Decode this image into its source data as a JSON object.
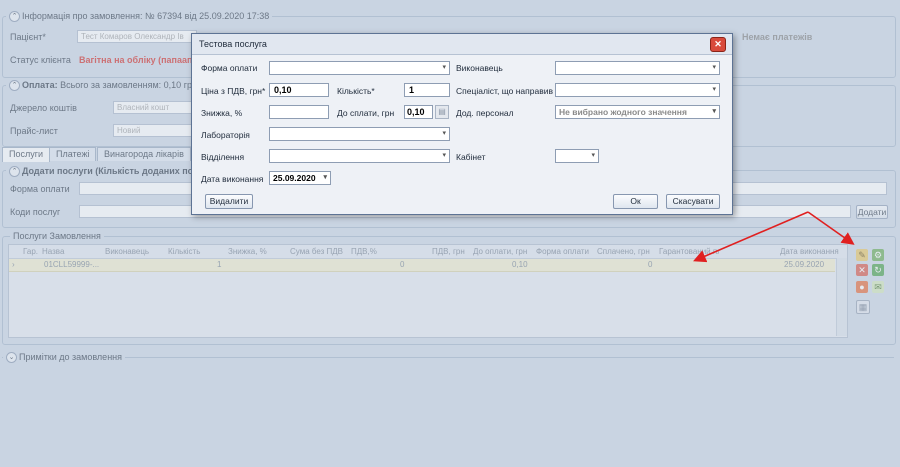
{
  "order_info": {
    "title": "Інформація про замовлення: № 67394 від 25.09.2020 17:38",
    "patient_label": "Пацієнт*",
    "patient_value": "Тест Комаров Олександр Ів",
    "status_label": "Статус клієнта",
    "status_value": "Вагітна на обліку (папаапап",
    "no_payments": "Немає платежів"
  },
  "payment": {
    "title": "Оплата:",
    "total": "Всього за замовленням: 0,10 грн.",
    "source_label": "Джерело коштів",
    "source_value": "Власний кошт",
    "pricelist_label": "Прайс-лист",
    "pricelist_value": "Новий"
  },
  "tabs": [
    {
      "label": "Послуги"
    },
    {
      "label": "Платежі"
    },
    {
      "label": "Винагорода лікарів"
    }
  ],
  "add_services": {
    "title": "Додати послуги (Кількість доданих посл",
    "payment_form_label": "Форма оплати",
    "codes_label": "Коди послуг",
    "add_button": "Додати"
  },
  "services": {
    "title": "Послуги Замовлення",
    "columns": [
      "Гар.",
      "Назва",
      "Виконавець",
      "Кількість",
      "Знижка, %",
      "Сума без ПДВ",
      "ПДВ,%",
      "ПДВ, грн",
      "До оплати, грн",
      "Форма оплати",
      "Сплачено, грн",
      "Гарантований платіж",
      "Дата виконання"
    ],
    "rows": [
      {
        "name": "01CLL59999-...",
        "qty": "1",
        "vat_amount": "0",
        "to_pay": "0,10",
        "paid": "0",
        "date": "25.09.2020"
      }
    ]
  },
  "notes": {
    "title": "Примітки до замовлення"
  },
  "dialog": {
    "title": "Тестова послуга",
    "payment_form_label": "Форма оплати",
    "payment_form_value": "",
    "executor_label": "Виконавець",
    "executor_value": "",
    "price_label": "Ціна з ПДВ, грн*",
    "price_value": "0,10",
    "qty_label": "Кількість*",
    "qty_value": "1",
    "referrer_label": "Спеціаліст, що направив",
    "referrer_value": "",
    "discount_label": "Знижка, %",
    "discount_value": "",
    "to_pay_label": "До сплати, грн",
    "to_pay_value": "0,10",
    "staff_label": "Дод. персонал",
    "staff_value": "Не вибрано жодного значення",
    "lab_label": "Лабораторія",
    "lab_value": "",
    "department_label": "Відділення",
    "department_value": "",
    "cabinet_label": "Кабінет",
    "cabinet_value": "",
    "date_label": "Дата виконання",
    "date_value": "25.09.2020",
    "delete_button": "Видалити",
    "ok_button": "Ок",
    "cancel_button": "Скасувати"
  },
  "colors": {
    "arrow": "#e02020",
    "highlight_row": "#f1edc9",
    "status_red": "#d0201a"
  }
}
